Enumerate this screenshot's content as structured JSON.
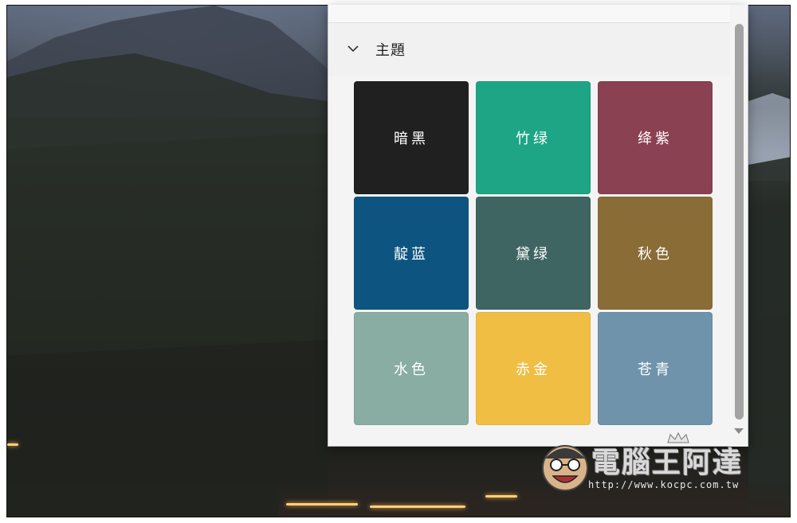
{
  "theme_section": {
    "title": "主題",
    "expanded_icon": "chevron-down-icon"
  },
  "themes": [
    {
      "label": "暗黑",
      "color": "#202020"
    },
    {
      "label": "竹绿",
      "color": "#1da585"
    },
    {
      "label": "绛紫",
      "color": "#8a4152"
    },
    {
      "label": "靛蓝",
      "color": "#0d5580"
    },
    {
      "label": "黛绿",
      "color": "#3e6562"
    },
    {
      "label": "秋色",
      "color": "#8a6c36"
    },
    {
      "label": "水色",
      "color": "#89ada2"
    },
    {
      "label": "赤金",
      "color": "#f0be43"
    },
    {
      "label": "苍青",
      "color": "#6f93aa"
    }
  ],
  "watermark": {
    "title": "電腦王阿達",
    "url": "http://www.kocpc.com.tw"
  }
}
